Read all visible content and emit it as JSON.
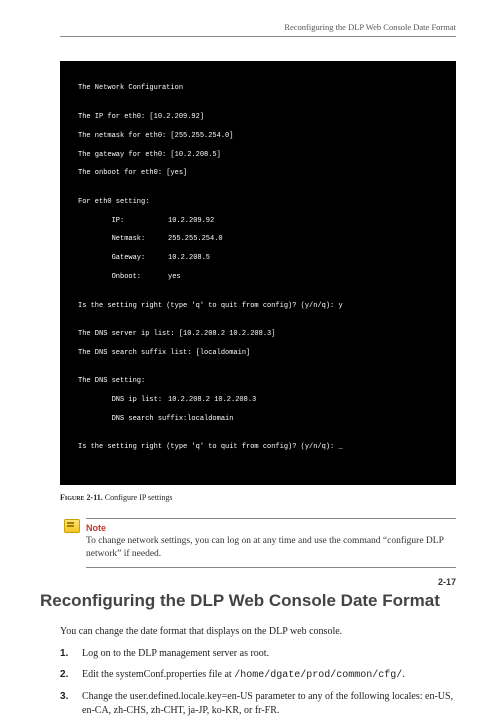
{
  "running_head": "Reconfiguring the DLP Web Console Date Format",
  "terminal": {
    "title": "The Network Configuration",
    "blank1": "",
    "ip_line": "The IP for eth0: [10.2.209.92]",
    "netmask_line": "The netmask for eth0: [255.255.254.0]",
    "gateway_line": "The gateway for eth0: [10.2.208.5]",
    "onboot_line": "The onboot for eth0: [yes]",
    "blank2": "",
    "for_eth0": "For eth0 setting:",
    "kv_ip_k": "        IP:",
    "kv_ip_v": "10.2.209.92",
    "kv_nm_k": "        Netmask:",
    "kv_nm_v": "255.255.254.0",
    "kv_gw_k": "        Gateway:",
    "kv_gw_v": "10.2.208.5",
    "kv_ob_k": "        Onboot:",
    "kv_ob_v": "yes",
    "blank3": "",
    "confirm1": "Is the setting right (type 'q' to quit from config)? (y/n/q): y",
    "blank4": "",
    "dns_server": "The DNS server ip list: [10.2.208.2 10.2.208.3]",
    "dns_suffix": "The DNS search suffix list: [localdomain]",
    "blank5": "",
    "dns_setting": "The DNS setting:",
    "dns_ip_k": "        DNS ip list:",
    "dns_ip_v": "10.2.208.2 10.2.208.3",
    "dns_sf_k": "        DNS search suffix:",
    "dns_sf_v": "localdomain",
    "blank6": "",
    "confirm2": "Is the setting right (type 'q' to quit from config)? (y/n/q): _"
  },
  "figure": {
    "label": "Figure 2-11.",
    "caption": "Configure IP settings"
  },
  "note": {
    "title": "Note",
    "text": "To change network settings, you can log on at any time and use the command “configure DLP network” if needed."
  },
  "heading": "Reconfiguring the DLP Web Console Date Format",
  "intro": "You can change the date format that displays on the DLP web console.",
  "steps": {
    "s1": "Log on to the DLP management server as root.",
    "s2_a": "Edit the systemConf.properties file at ",
    "s2_b": "/home/dgate/prod/common/cfg/",
    "s2_c": ".",
    "s3": "Change the user.defined.locale.key=en-US parameter to any of the following locales: en-US, en-CA, zh-CHS, zh-CHT, ja-JP, ko-KR, or fr-FR."
  },
  "page_number": "2-17"
}
